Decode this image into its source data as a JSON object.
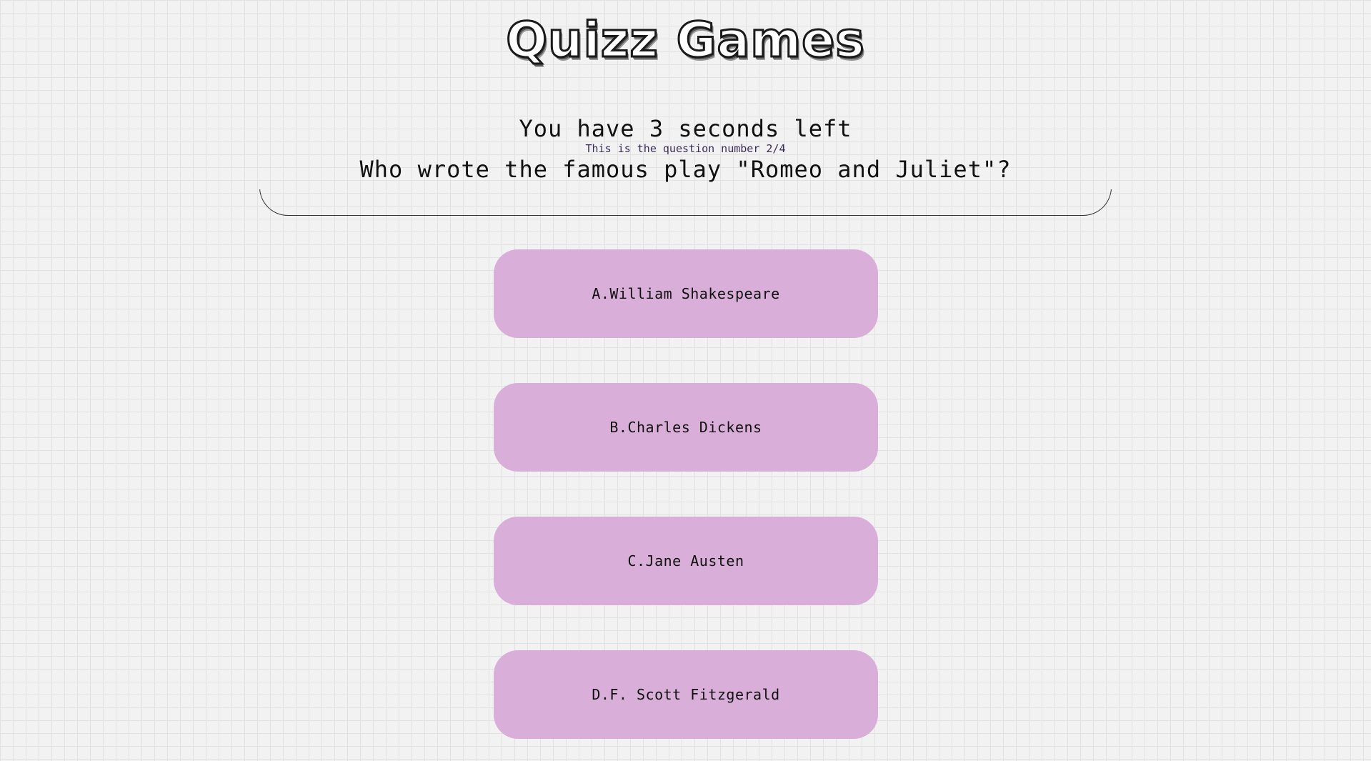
{
  "app": {
    "title": "Quizz Games"
  },
  "status": {
    "timer_text": "You have 3 seconds left",
    "question_number_text": "This is the question number 2/4"
  },
  "question": {
    "text": "Who wrote the famous play \"Romeo and Juliet\"?"
  },
  "answers": [
    {
      "label": "A.William Shakespeare"
    },
    {
      "label": "B.Charles Dickens"
    },
    {
      "label": "C.Jane Austen"
    },
    {
      "label": "D.F. Scott Fitzgerald"
    }
  ],
  "colors": {
    "answer_background": "#d9aed9",
    "page_background": "#f2f2f2"
  }
}
